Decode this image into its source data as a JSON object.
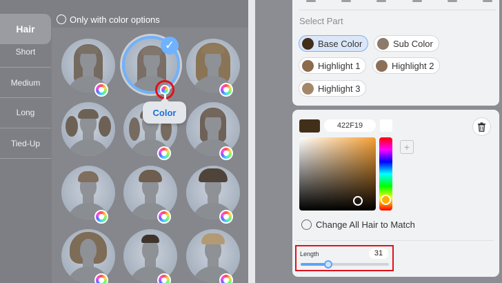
{
  "left_panel": {
    "filter_label": "Only with color options",
    "categories": [
      {
        "label": "Hair",
        "active": true
      },
      {
        "label": "Short",
        "active": false
      },
      {
        "label": "Medium",
        "active": false
      },
      {
        "label": "Long",
        "active": false
      },
      {
        "label": "Tied-Up",
        "active": false
      }
    ],
    "tooltip_label": "Color",
    "hairstyles": [
      {
        "name": "long-wavy",
        "has_color": true,
        "selected": false
      },
      {
        "name": "long-straight",
        "has_color": true,
        "selected": true
      },
      {
        "name": "long-curly",
        "has_color": true,
        "selected": false
      },
      {
        "name": "twin-tails",
        "has_color": false,
        "selected": false
      },
      {
        "name": "pigtails",
        "has_color": true,
        "selected": false
      },
      {
        "name": "braid",
        "has_color": true,
        "selected": false
      },
      {
        "name": "short-textured",
        "has_color": true,
        "selected": false
      },
      {
        "name": "short-curly",
        "has_color": true,
        "selected": false
      },
      {
        "name": "short-twists",
        "has_color": true,
        "selected": false
      },
      {
        "name": "afro-curl",
        "has_color": true,
        "selected": false
      },
      {
        "name": "short-crop",
        "has_color": true,
        "selected": false
      },
      {
        "name": "short-spiky",
        "has_color": true,
        "selected": false
      }
    ]
  },
  "select_part": {
    "label": "Select Part",
    "parts": [
      {
        "label": "Base Color",
        "color": "#422f19",
        "active": true
      },
      {
        "label": "Sub Color",
        "color": "#8c7a6b",
        "active": false
      },
      {
        "label": "Highlight 1",
        "color": "#8b6a4e",
        "active": false
      },
      {
        "label": "Highlight 2",
        "color": "#8d6f58",
        "active": false
      },
      {
        "label": "Highlight 3",
        "color": "#a4876a",
        "active": false
      }
    ]
  },
  "color_picker": {
    "current_color": "#422f19",
    "hex_value": "422F19",
    "delete_icon": "trash-icon",
    "add_icon": "plus-icon",
    "match_label": "Change All Hair to Match"
  },
  "length": {
    "label": "Length",
    "value": "31",
    "fraction": 0.31
  }
}
